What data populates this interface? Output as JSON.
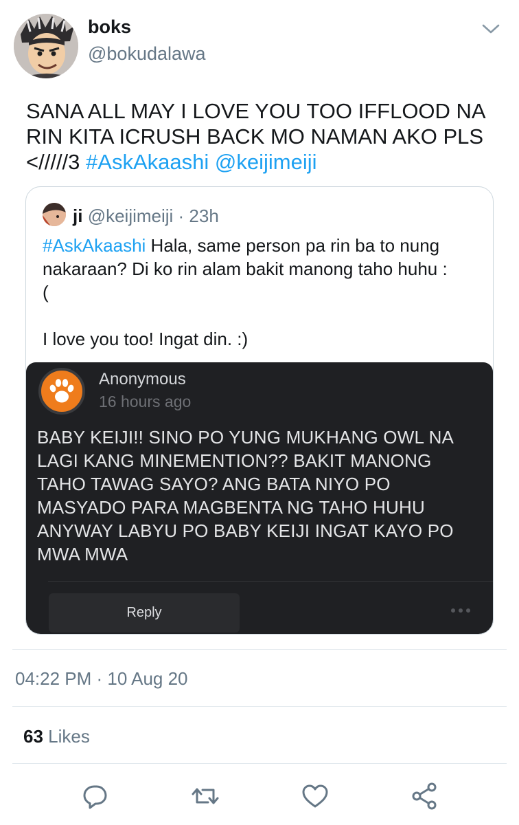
{
  "tweet": {
    "display_name": "boks",
    "handle": "@bokudalawa",
    "text_lines": [
      "SANA ALL MAY I LOVE YOU TOO IFFLOOD NA",
      "RIN KITA ICRUSH BACK MO NAMAN AKO PLS",
      "</////3"
    ],
    "hashtag": "#AskAkaashi",
    "mention": "@keijimeiji"
  },
  "quote": {
    "name": "ji",
    "meta": "@keijimeiji · 23h",
    "hashtag": "#AskAkaashi",
    "line1_rest": "Hala, same person pa rin ba to nung",
    "line2": "nakaraan? Di ko rin alam bakit manong taho huhu :",
    "line3": "(",
    "line5": "I love you too! Ingat din. :)"
  },
  "card": {
    "sender": "Anonymous",
    "time": "16 hours ago",
    "message_lines": [
      "BABY KEIJI!! SINO PO YUNG MUKHANG OWL NA",
      "LAGI KANG MINEMENTION?? BAKIT MANONG",
      "TAHO TAWAG SAYO? ANG BATA NIYO PO",
      "MASYADO PARA MAGBENTA NG TAHO HUHU",
      "ANYWAY LABYU PO BABY KEIJI INGAT KAYO PO",
      "MWA MWA"
    ],
    "reply_label": "Reply",
    "more_icon": "more-dots-icon"
  },
  "footer": {
    "timestamp": "04:22 PM · 10 Aug 20",
    "likes_count": "63",
    "likes_label": "Likes"
  },
  "actions": {
    "icons": [
      "reply-icon",
      "retweet-icon",
      "like-icon",
      "share-icon"
    ]
  },
  "colors": {
    "link": "#1da1f2",
    "secondary_text": "#657786",
    "card_bg": "#1f2023",
    "paw_orange": "#ef7c1c"
  }
}
